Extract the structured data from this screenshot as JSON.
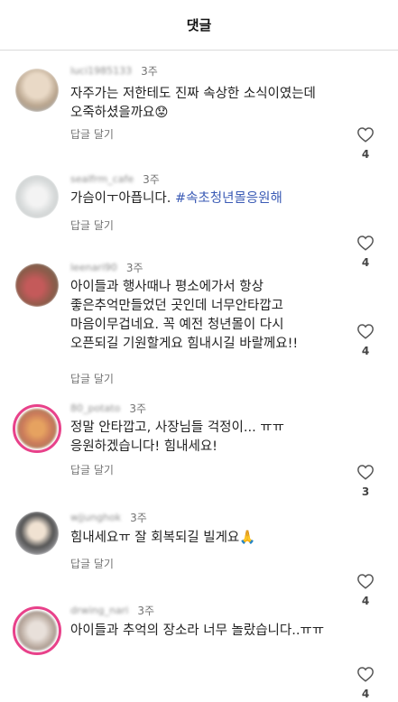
{
  "header": {
    "title": "댓글"
  },
  "comments": [
    {
      "username": "luci1985133",
      "time": "3주",
      "text": "자주가는 저한테도 진짜 속상한 소식이였는데 오죽하셨을까요",
      "emoji": "😟",
      "reply_label": "답글 달기",
      "likes": "4"
    },
    {
      "username": "sealfrm_cafe",
      "time": "3주",
      "text": "가슴이ㅜ아픕니다. ",
      "hashtag": "#속초청년몰응원해",
      "reply_label": "답글 달기",
      "likes": "4"
    },
    {
      "username": "leenari90",
      "time": "3주",
      "text": "아이들과 행사때나 평소에가서 항상 좋은추억만들었던 곳인데 너무안타깝고 마음이무겁네요. 꼭 예전 청년몰이 다시 오픈되길 기원할게요 힘내시길 바랄께요!!",
      "reply_label": "답글 달기",
      "likes": "4"
    },
    {
      "username": "80_potato",
      "time": "3주",
      "text": "정말 안타깝고, 사장님들 걱정이... ㅠㅠ 응원하겠습니다! 힘내세요!",
      "reply_label": "답글 달기",
      "likes": "3"
    },
    {
      "username": "wjjunghok",
      "time": "3주",
      "text": "힘내세요ㅠ 잘 회복되길 빌게요",
      "emoji": "🙏",
      "reply_label": "답글 달기",
      "likes": "4"
    },
    {
      "username": "drwing_nari",
      "time": "3주",
      "text": "아이들과 추억의 장소라 너무 놀랐습니다..ㅠㅠ",
      "likes": "4"
    }
  ]
}
